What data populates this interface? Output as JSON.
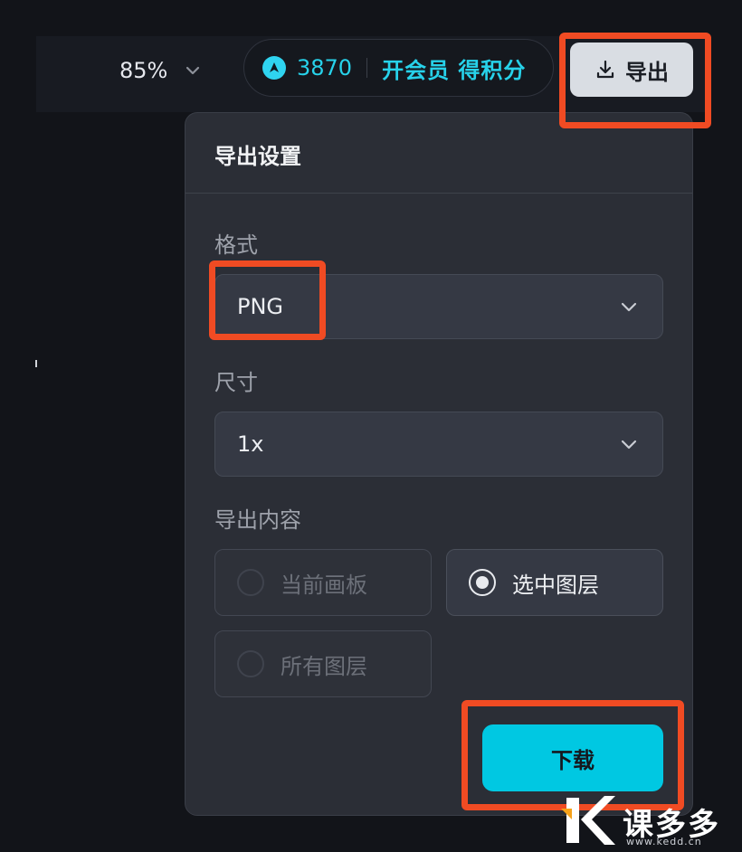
{
  "toolbar": {
    "zoom_label": "85%",
    "points_value": "3870",
    "membership_link": "开会员 得积分",
    "export_button_label": "导出"
  },
  "export_panel": {
    "title": "导出设置",
    "format": {
      "label": "格式",
      "selected": "PNG"
    },
    "size": {
      "label": "尺寸",
      "selected": "1x"
    },
    "content": {
      "label": "导出内容",
      "options": [
        {
          "label": "当前画板",
          "state": "disabled"
        },
        {
          "label": "选中图层",
          "state": "selected"
        },
        {
          "label": "所有图层",
          "state": "disabled"
        }
      ]
    },
    "download_button_label": "下载"
  },
  "watermark": {
    "text": "课多多",
    "url": "www.kedd.cn"
  },
  "colors": {
    "accent": "#00c8e2",
    "points": "#27d2ea",
    "highlight": "#f04b23",
    "panel_bg": "#2b2e36",
    "page_bg": "#121419"
  }
}
